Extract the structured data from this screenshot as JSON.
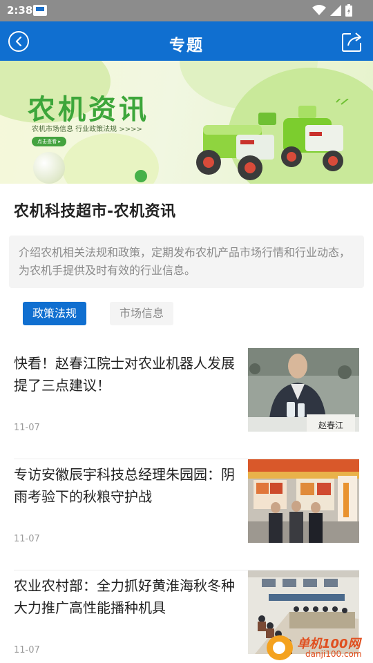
{
  "status_bar": {
    "time": "2:38"
  },
  "header": {
    "title": "专题"
  },
  "banner": {
    "title": "农机资讯",
    "subtitle": "农机市场信息  行业政策法规 >>>>",
    "button": "点击查看 ▸"
  },
  "section": {
    "title": "农机科技超市-农机资讯",
    "description": "介绍农机相关法规和政策，定期发布农机产品市场行情和行业动态，为农机手提供及时有效的行业信息。"
  },
  "tabs": [
    {
      "label": "政策法规",
      "active": true
    },
    {
      "label": "市场信息",
      "active": false
    }
  ],
  "news": [
    {
      "title": "快看！赵春江院士对农业机器人发展提了三点建议！",
      "date": "11-07",
      "caption": "赵春江"
    },
    {
      "title": "专访安徽辰宇科技总经理朱园园：阴雨考验下的秋粮守护战",
      "date": "11-07"
    },
    {
      "title": "农业农村部：全力抓好黄淮海秋冬种 大力推广高性能播种机具",
      "date": "11-07"
    }
  ],
  "watermark": {
    "name": "单机100网",
    "url": "danji100.com"
  },
  "colors": {
    "primary": "#106fd0",
    "banner_green": "#3da63a"
  }
}
